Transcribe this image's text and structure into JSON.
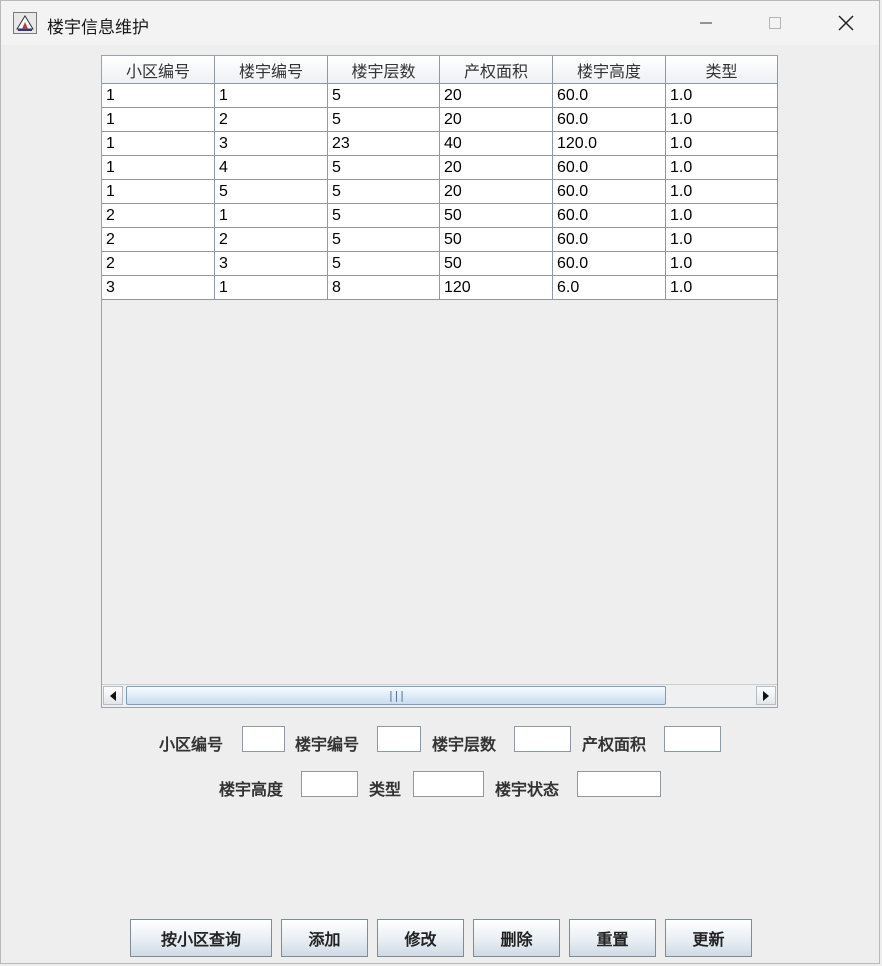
{
  "window": {
    "title": "楼宇信息维护",
    "controls": [
      "minimize-icon",
      "maximize-icon",
      "close-icon"
    ]
  },
  "table": {
    "columns": [
      "小区编号",
      "楼宇编号",
      "楼宇层数",
      "产权面积",
      "楼宇高度",
      "类型"
    ],
    "rows": [
      [
        "1",
        "1",
        "5",
        "20",
        "60.0",
        "1.0"
      ],
      [
        "1",
        "2",
        "5",
        "20",
        "60.0",
        "1.0"
      ],
      [
        "1",
        "3",
        "23",
        "40",
        "120.0",
        "1.0"
      ],
      [
        "1",
        "4",
        "5",
        "20",
        "60.0",
        "1.0"
      ],
      [
        "1",
        "5",
        "5",
        "20",
        "60.0",
        "1.0"
      ],
      [
        "2",
        "1",
        "5",
        "50",
        "60.0",
        "1.0"
      ],
      [
        "2",
        "2",
        "5",
        "50",
        "60.0",
        "1.0"
      ],
      [
        "2",
        "3",
        "5",
        "50",
        "60.0",
        "1.0"
      ],
      [
        "3",
        "1",
        "8",
        "120",
        "6.0",
        "1.0"
      ]
    ],
    "scrollbar": {
      "thumb_grip": "|||"
    }
  },
  "form": {
    "community_id_label": "小区编号",
    "building_id_label": "楼宇编号",
    "floors_label": "楼宇层数",
    "area_label": "产权面积",
    "height_label": "楼宇高度",
    "type_label": "类型",
    "status_label": "楼宇状态",
    "community_id_value": "",
    "building_id_value": "",
    "floors_value": "",
    "area_value": "",
    "height_value": "",
    "type_value": "",
    "status_value": ""
  },
  "buttons": {
    "query_by_community": "按小区查询",
    "add": "添加",
    "modify": "修改",
    "delete": "删除",
    "reset": "重置",
    "update": "更新"
  }
}
